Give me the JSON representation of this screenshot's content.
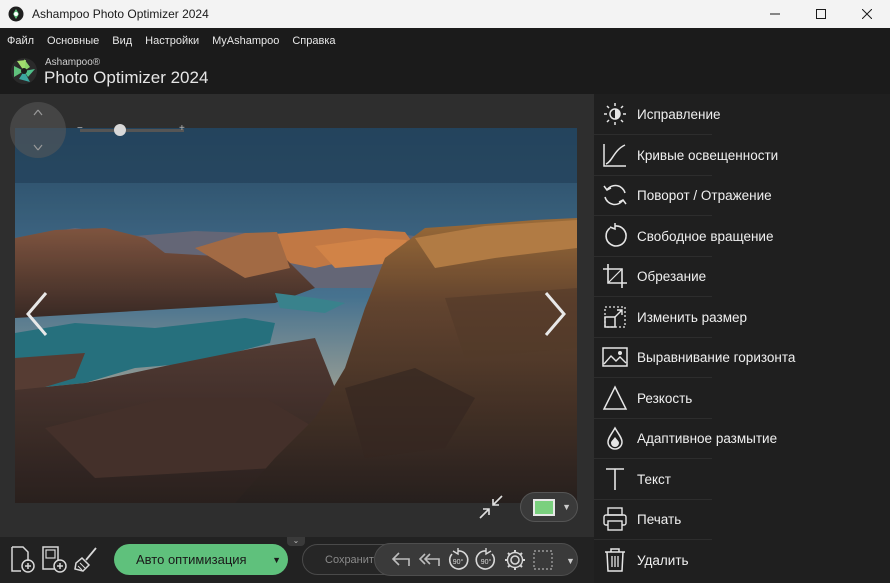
{
  "window": {
    "title": "Ashampoo Photo Optimizer 2024",
    "controls": [
      "minimize-icon",
      "maximize-icon",
      "close-icon"
    ]
  },
  "menu": {
    "items": [
      "Файл",
      "Основные",
      "Вид",
      "Настройки",
      "MyAshampoo",
      "Справка"
    ]
  },
  "logo": {
    "small": "Ashampoo®",
    "big": "Photo Optimizer 2024"
  },
  "viewer": {
    "prev_icon": "chevron-left-icon",
    "next_icon": "chevron-right-icon",
    "zoom_minus": "−",
    "zoom_plus": "+",
    "zoom_level": 0.38
  },
  "bottom_toolbar": {
    "auto_optimize_label": "Авто оптимизация",
    "save_label": "Сохранить",
    "left_icons": [
      "add-file-icon",
      "add-folder-icon",
      "clean-brush-icon"
    ],
    "tool_icons": [
      "undo-icon",
      "undo-all-icon",
      "rotate-left-90-icon",
      "rotate-right-90-icon",
      "settings-gear-icon",
      "select-all-icon"
    ],
    "rotate_label": "90°"
  },
  "tools": [
    {
      "label": "Исправление",
      "icon": "sun-adjust-icon"
    },
    {
      "label": "Кривые освещенности",
      "icon": "curves-icon"
    },
    {
      "label": "Поворот / Отражение",
      "icon": "rotate-flip-icon"
    },
    {
      "label": "Свободное вращение",
      "icon": "free-rotate-icon"
    },
    {
      "label": "Обрезание",
      "icon": "crop-icon"
    },
    {
      "label": "Изменить размер",
      "icon": "resize-icon"
    },
    {
      "label": "Выравнивание горизонта",
      "icon": "horizon-icon"
    },
    {
      "label": "Резкость",
      "icon": "sharpen-triangle-icon"
    },
    {
      "label": "Адаптивное размытие",
      "icon": "blur-drop-icon"
    },
    {
      "label": "Текст",
      "icon": "text-icon"
    },
    {
      "label": "Печать",
      "icon": "print-icon"
    },
    {
      "label": "Удалить",
      "icon": "trash-icon"
    }
  ],
  "colors": {
    "accent_green": "#5fc17c",
    "background": "#1b1b1b",
    "panel": "#1f1f1f"
  }
}
